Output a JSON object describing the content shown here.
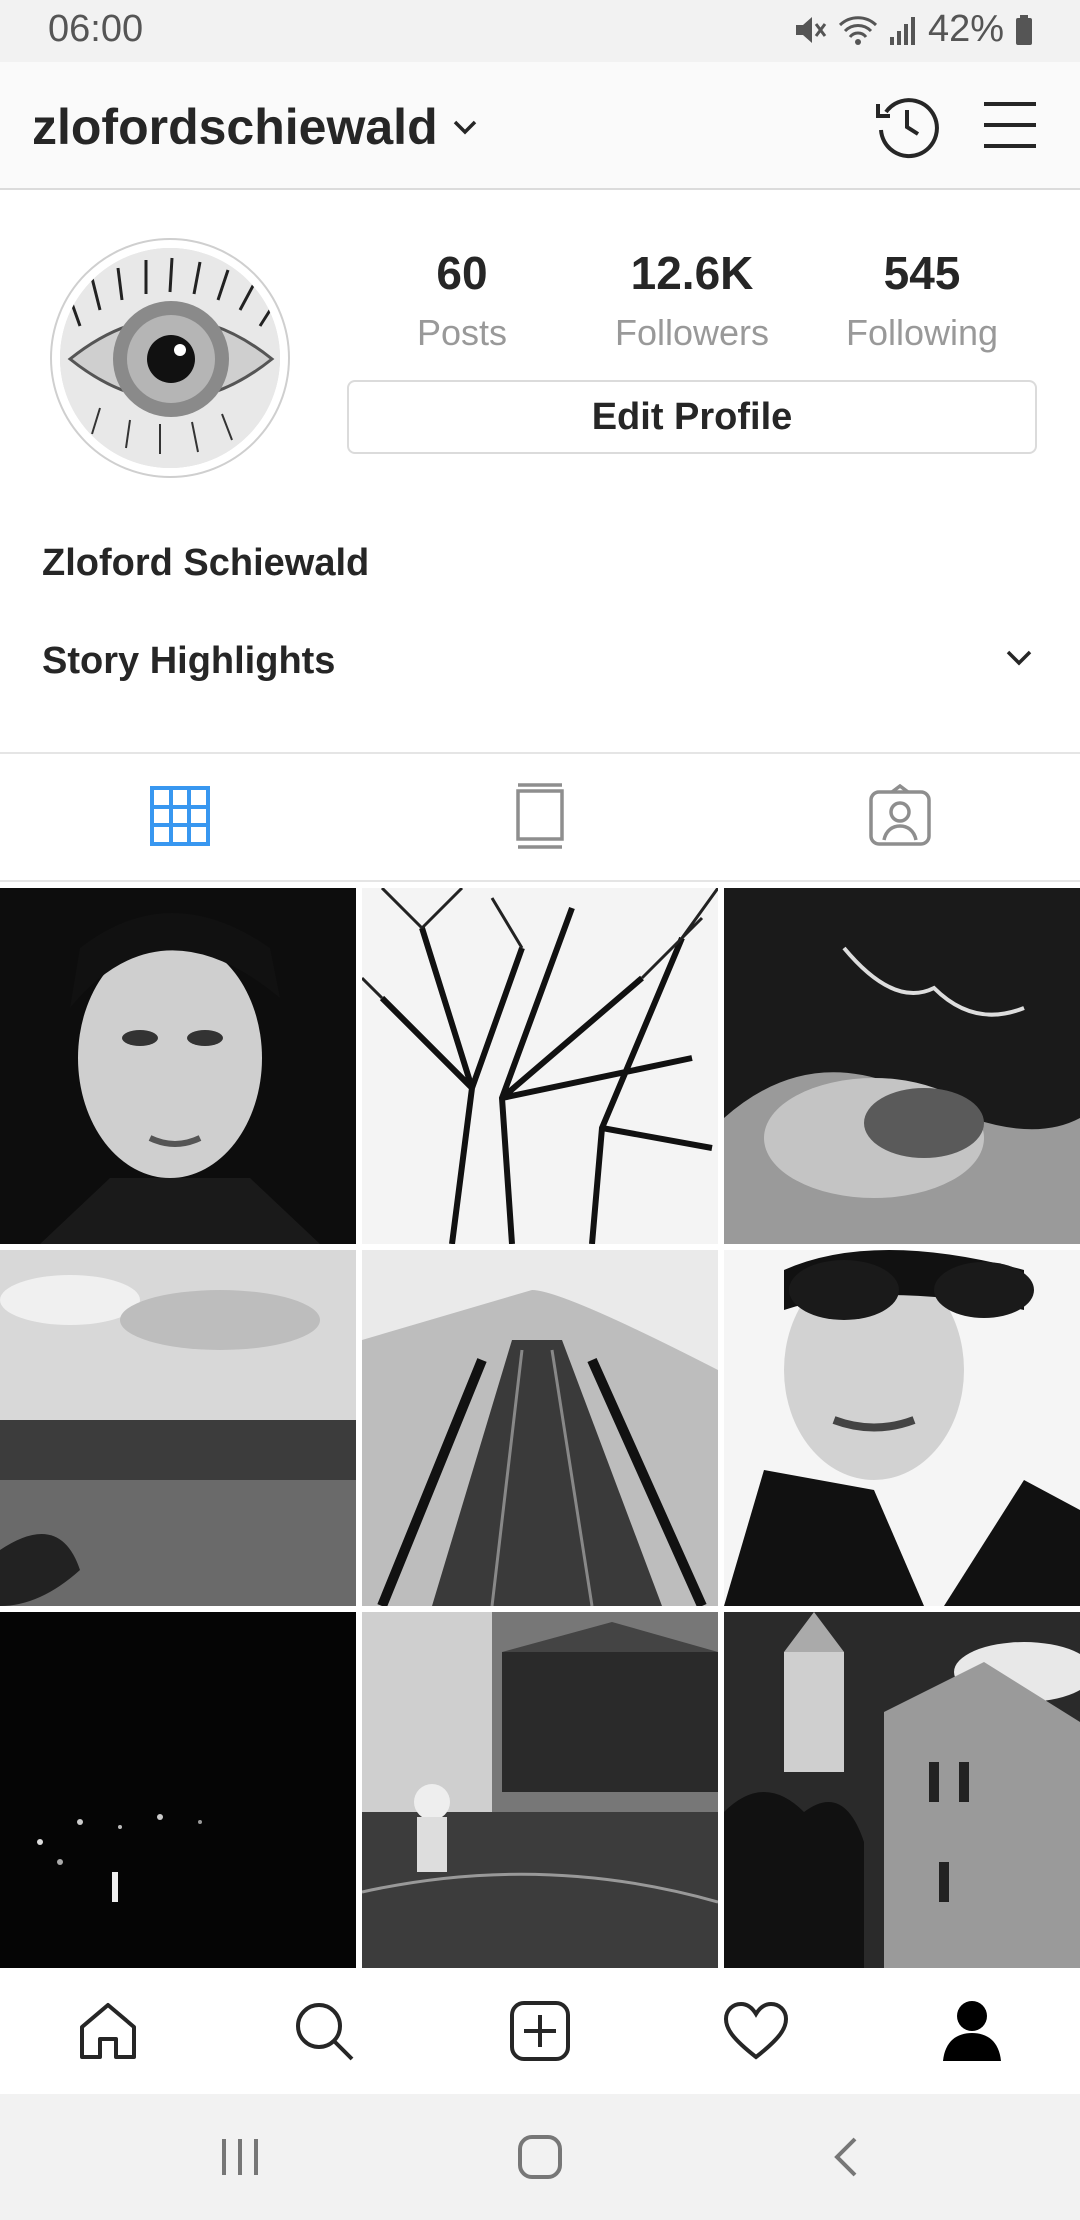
{
  "status_bar": {
    "time": "06:00",
    "battery": "42%"
  },
  "header": {
    "username": "zlofordschiewald"
  },
  "profile": {
    "stats": [
      {
        "value": "60",
        "label": "Posts"
      },
      {
        "value": "12.6K",
        "label": "Followers"
      },
      {
        "value": "545",
        "label": "Following"
      }
    ],
    "edit_button": "Edit Profile",
    "full_name": "Zloford Schiewald",
    "story_highlights": "Story Highlights"
  },
  "tabs": [
    "grid-icon",
    "feed-icon",
    "tagged-icon"
  ],
  "bottom_nav": [
    "home-icon",
    "search-icon",
    "add-post-icon",
    "heart-icon",
    "profile-icon"
  ],
  "colors": {
    "accent": "#3897f0",
    "text": "#262626",
    "muted": "#999999",
    "border": "#dbdbdb"
  }
}
